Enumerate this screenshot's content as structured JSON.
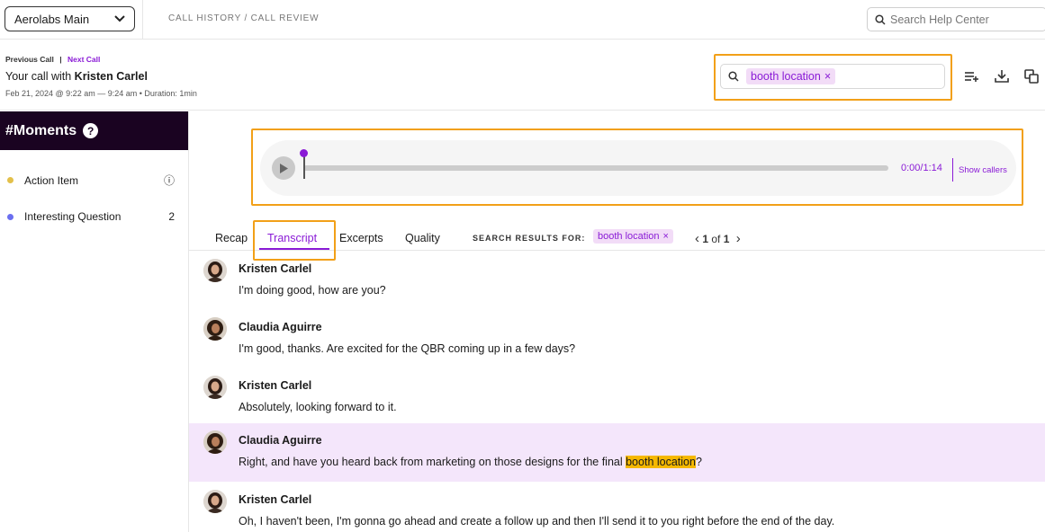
{
  "topbar": {
    "workspace": "Aerolabs Main",
    "breadcrumb": "CALL HISTORY / CALL REVIEW",
    "help_search_placeholder": "Search Help Center"
  },
  "call": {
    "previous": "Previous Call",
    "separator": "|",
    "next": "Next Call",
    "title_prefix": "Your call with",
    "caller": "Kristen Carlel",
    "meta": "Feb 21, 2024 @ 9:22 am — 9:24 am • Duration: 1min",
    "search_term": "booth location",
    "chip_close": "×"
  },
  "sidebar": {
    "title": "#Moments",
    "help_badge": "?",
    "moments": [
      {
        "label": "Action Item",
        "color": "#e3c04a",
        "value": "ⓘ"
      },
      {
        "label": "Interesting Question",
        "color": "#6b6ff0",
        "value": "2"
      }
    ]
  },
  "player": {
    "time": "0:00/1:14",
    "show_callers": "Show callers",
    "progress": 0
  },
  "tabs": {
    "items": [
      "Recap",
      "Transcript",
      "Excerpts",
      "Quality"
    ],
    "active": "Transcript",
    "search_results_label": "SEARCH RESULTS FOR:",
    "search_chip": "booth location",
    "pager_prev": "‹",
    "pager_current": "1",
    "pager_of": "of",
    "pager_total": "1",
    "pager_next": "›"
  },
  "transcript": [
    {
      "speaker": "Kristen Carlel",
      "text": "I'm doing good, how are you?",
      "highlight": false
    },
    {
      "speaker": "Claudia Aguirre",
      "text": "I'm good, thanks. Are excited for the QBR coming up in a few days?",
      "highlight": false
    },
    {
      "speaker": "Kristen Carlel",
      "text": "Absolutely, looking forward to it.",
      "highlight": false
    },
    {
      "speaker": "Claudia Aguirre",
      "text_before": "Right, and have you heard back from marketing on those designs for the final ",
      "text_match": "booth location",
      "text_after": "?",
      "highlight": true
    },
    {
      "speaker": "Kristen Carlel",
      "text": "Oh, I haven't been, I'm gonna go ahead and create a follow up and then I'll send it to you right before the end of the day.",
      "highlight": false
    }
  ],
  "colors": {
    "accent": "#8a1bd6",
    "focus_outline": "#f2a018",
    "match_highlight": "#f5b800",
    "row_highlight": "#f4e6fb",
    "sidebar_header": "#1a0321"
  }
}
